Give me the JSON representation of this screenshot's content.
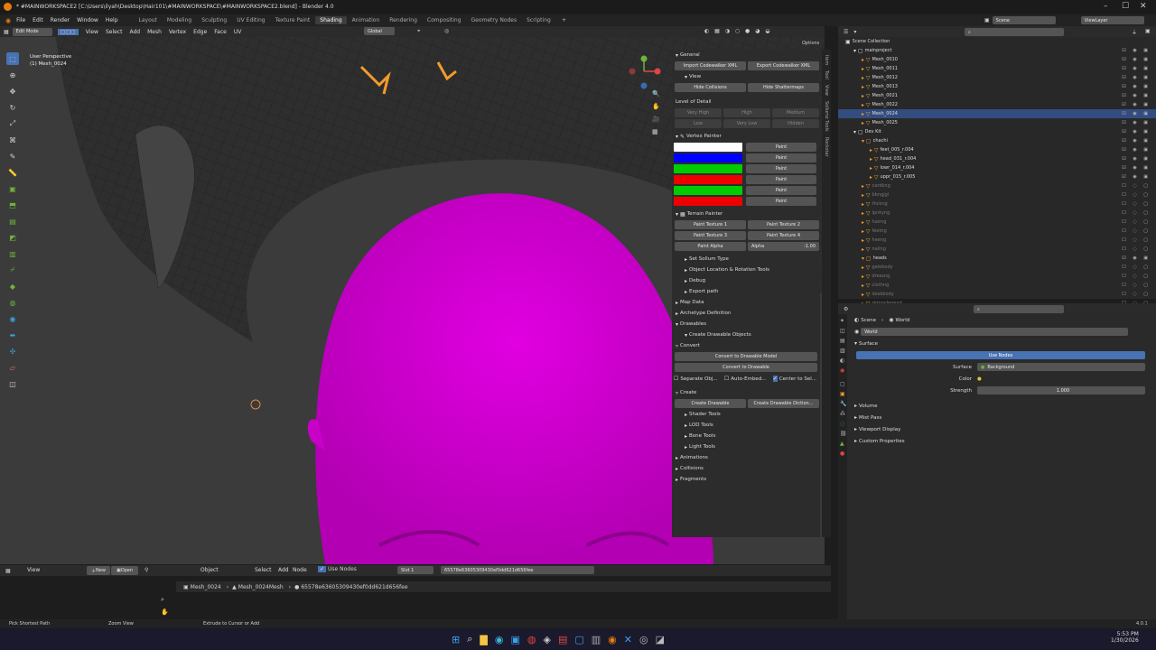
{
  "window": {
    "title": "* #MAINWORKSPACE2 [C:\\Users\\ilyah\\Desktop\\Hair101\\#MAINWORKSPACE\\#MAINWORKSPACE2.blend] - Blender 4.0"
  },
  "menu": [
    "File",
    "Edit",
    "Render",
    "Window",
    "Help"
  ],
  "workspaces": [
    "Layout",
    "Modeling",
    "Sculpting",
    "UV Editing",
    "Texture Paint",
    "Shading",
    "Animation",
    "Rendering",
    "Compositing",
    "Geometry Nodes",
    "Scripting"
  ],
  "active_workspace": "Shading",
  "top_right": {
    "scene": "Scene",
    "view_layer": "ViewLayer"
  },
  "viewport": {
    "mode": "Edit Mode",
    "menus": [
      "View",
      "Select",
      "Add",
      "Mesh",
      "Vertex",
      "Edge",
      "Face",
      "UV"
    ],
    "orientation": "Global",
    "options": "Options",
    "overlay_title": "User Perspective",
    "overlay_object": "(1) Mesh_0024",
    "colors": {
      "mesh": "#d400d4",
      "bg": "#3a3a3a"
    }
  },
  "npanel": {
    "general": "General",
    "import_xml": "Import Codewalker XML",
    "export_xml": "Export Codewalker XML",
    "view": "View",
    "hide_collisions": "Hide Collisions",
    "hide_shattermaps": "Hide Shattermaps",
    "lod_label": "Level of Detail",
    "lod_buttons": [
      "Very High",
      "High",
      "Medium",
      "Low",
      "Very Low",
      "Hidden"
    ],
    "vertex_painter": "Vertex Painter",
    "paint": "Paint",
    "swatches": [
      "#ffffff",
      "#0000ff",
      "#00cc00",
      "#ee0000",
      "#00cc00",
      "#ee0000"
    ],
    "terrain_painter": "Terrain Painter",
    "paint_textures": [
      "Paint Texture 1",
      "Paint Texture 2",
      "Paint Texture 3",
      "Paint Texture 4"
    ],
    "paint_alpha": "Paint Alpha",
    "alpha_label": "Alpha",
    "alpha_value": "-1.00",
    "sections": [
      "Set Sollum Type",
      "Object Location & Rotation Tools",
      "Debug",
      "Export path",
      "Map Data",
      "Archetype Definition",
      "Drawables"
    ],
    "create_drawable_objects": "Create Drawable Objects",
    "convert": "Convert",
    "convert_model": "Convert to Drawable Model",
    "convert_drawable": "Convert to Drawable",
    "separate_obj": "Separate Obj...",
    "auto_embed": "Auto-Embed...",
    "center_to_sel": "Center to Sel...",
    "create": "Create",
    "create_drawable": "Create Drawable",
    "create_drawable_dict": "Create Drawable Diction...",
    "tools": [
      "Shader Tools",
      "LOD Tools",
      "Bone Tools",
      "Light Tools"
    ],
    "tail_sections": [
      "Animations",
      "Collisions",
      "Fragments"
    ],
    "tabs": [
      "Item",
      "Tool",
      "View",
      "Sollumz Tools",
      "Rockstar"
    ]
  },
  "outliner": {
    "search_placeholder": "",
    "rows": [
      {
        "name": "Scene Collection",
        "indent": 0,
        "dim": false,
        "hl": false
      },
      {
        "name": "mainproject",
        "indent": 1,
        "dim": false,
        "hl": false
      },
      {
        "name": "Mesh_0010",
        "indent": 2,
        "dim": false,
        "hl": false
      },
      {
        "name": "Mesh_0011",
        "indent": 2,
        "dim": false,
        "hl": false
      },
      {
        "name": "Mesh_0012",
        "indent": 2,
        "dim": false,
        "hl": false
      },
      {
        "name": "Mesh_0013",
        "indent": 2,
        "dim": false,
        "hl": false
      },
      {
        "name": "Mesh_0021",
        "indent": 2,
        "dim": false,
        "hl": false
      },
      {
        "name": "Mesh_0022",
        "indent": 2,
        "dim": false,
        "hl": false
      },
      {
        "name": "Mesh_0024",
        "indent": 2,
        "dim": false,
        "hl": true
      },
      {
        "name": "Mesh_0025",
        "indent": 2,
        "dim": false,
        "hl": false
      },
      {
        "name": "Dev Kit",
        "indent": 1,
        "dim": false,
        "hl": false
      },
      {
        "name": "chachi",
        "indent": 2,
        "dim": false,
        "hl": false
      },
      {
        "name": "feet_005_r.004",
        "indent": 3,
        "dim": false,
        "hl": false
      },
      {
        "name": "head_031_r.004",
        "indent": 3,
        "dim": false,
        "hl": false
      },
      {
        "name": "lowr_014_r.004",
        "indent": 3,
        "dim": false,
        "hl": false
      },
      {
        "name": "uppr_015_r.005",
        "indent": 3,
        "dim": false,
        "hl": false
      },
      {
        "name": "cardkng",
        "indent": 2,
        "dim": true,
        "hl": false
      },
      {
        "name": "bbngjgl",
        "indent": 2,
        "dim": true,
        "hl": false
      },
      {
        "name": "thckng",
        "indent": 2,
        "dim": true,
        "hl": false
      },
      {
        "name": "lpnkyng",
        "indent": 2,
        "dim": true,
        "hl": false
      },
      {
        "name": "hairng",
        "indent": 2,
        "dim": true,
        "hl": false
      },
      {
        "name": "feetng",
        "indent": 2,
        "dim": true,
        "hl": false
      },
      {
        "name": "heeng",
        "indent": 2,
        "dim": true,
        "hl": false
      },
      {
        "name": "nailng",
        "indent": 2,
        "dim": true,
        "hl": false
      },
      {
        "name": "heads",
        "indent": 2,
        "dim": false,
        "hl": false
      },
      {
        "name": "gelebody",
        "indent": 2,
        "dim": true,
        "hl": false
      },
      {
        "name": "dressng",
        "indent": 2,
        "dim": true,
        "hl": false
      },
      {
        "name": "clothng",
        "indent": 2,
        "dim": true,
        "hl": false
      },
      {
        "name": "deskbody",
        "indent": 2,
        "dim": true,
        "hl": false
      },
      {
        "name": "skinnylegend",
        "indent": 2,
        "dim": true,
        "hl": false
      }
    ]
  },
  "properties": {
    "breadcrumb": [
      "Scene",
      "World"
    ],
    "world_name": "World",
    "surface": "Surface",
    "use_nodes": "Use Nodes",
    "surface_label": "Surface",
    "surface_value": "Background",
    "color_label": "Color",
    "strength_label": "Strength",
    "strength_value": "1.000",
    "panels": [
      "Volume",
      "Mist Pass",
      "Viewport Display",
      "Custom Properties"
    ]
  },
  "bottom": {
    "menus": [
      "View",
      "Object",
      "Select",
      "Add",
      "Node"
    ],
    "new_label": "New",
    "open_label": "Open",
    "use_nodes": "Use Nodes",
    "slot": "Slot 1",
    "material_id": "65578e6360530943​0ef0dd621d656fee",
    "breadcrumb": [
      "Mesh_0024",
      "Mesh_0024Mesh",
      "65578e63605309430ef0dd621d656fee"
    ]
  },
  "status": {
    "left": "Pick Shortest Path",
    "middle": "Zoom View",
    "right": "Extrude to Cursor or Add",
    "version": "4.0.1"
  },
  "taskbar": {
    "time": "5:53 PM",
    "date": "1/30/2026"
  }
}
